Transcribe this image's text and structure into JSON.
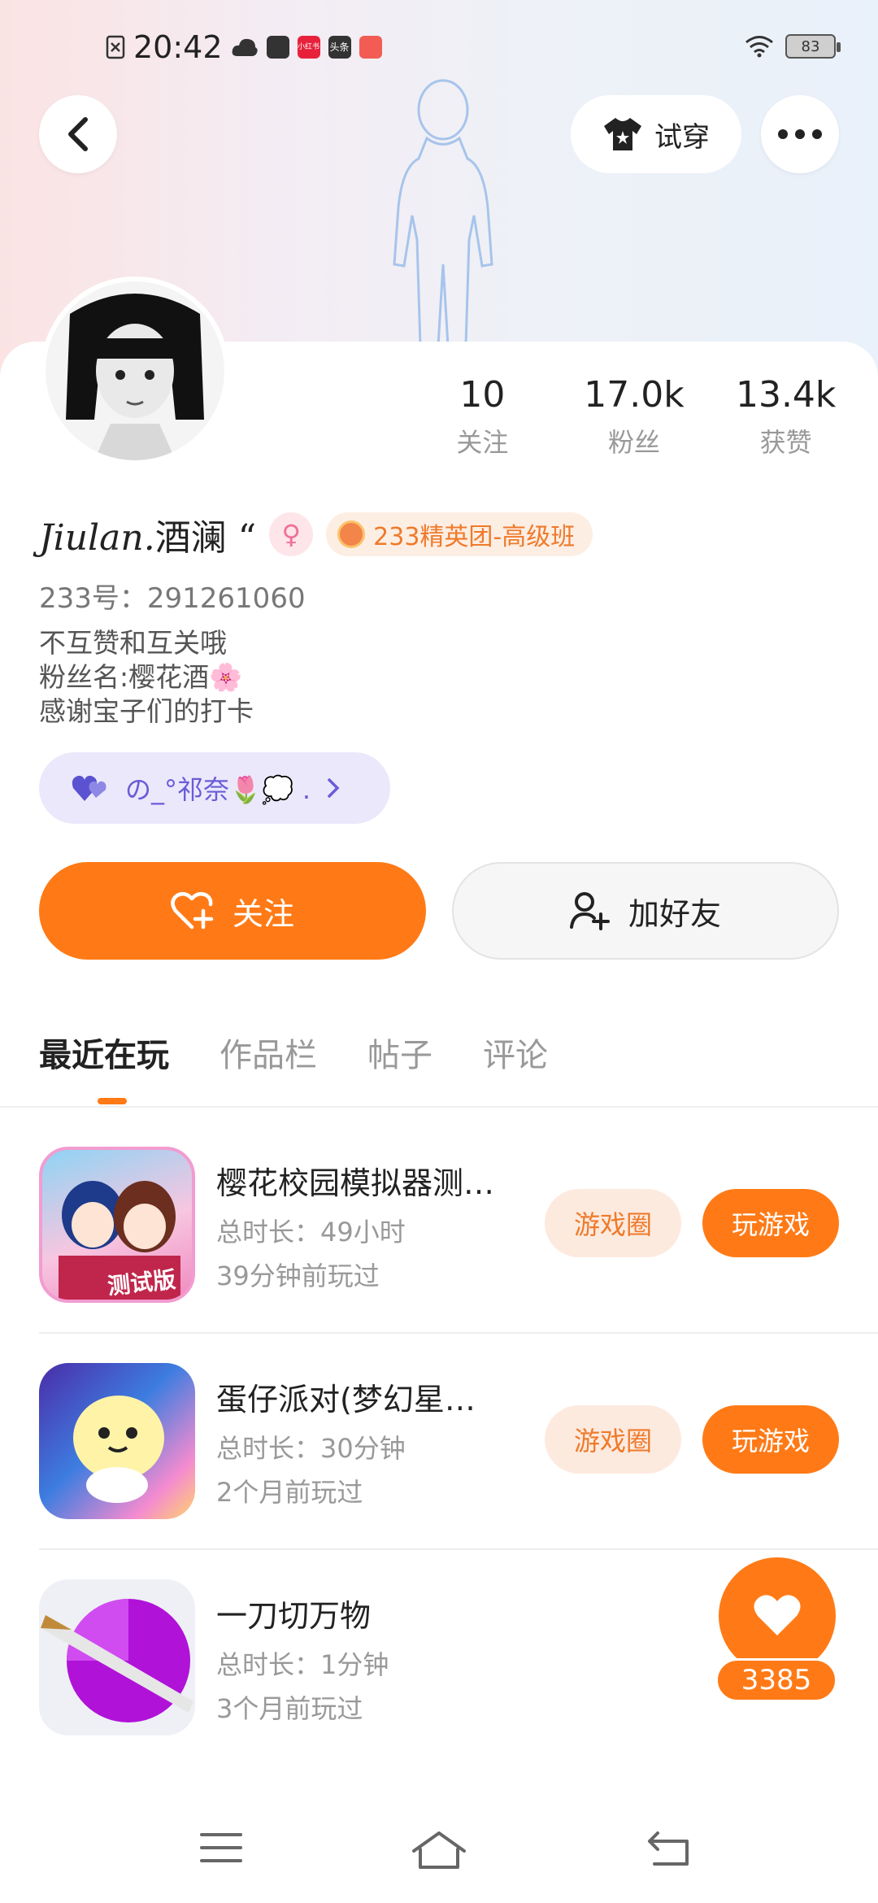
{
  "status_bar": {
    "time": "20:42",
    "battery": "83",
    "icons": [
      "sim-off-icon",
      "cloud-icon",
      "app-icon",
      "xiaohongshu-icon",
      "toutiao-icon",
      "app2-icon",
      "wifi-icon"
    ],
    "app_badges": [
      "小红书",
      "头条"
    ]
  },
  "header": {
    "back_icon": "chevron-left-icon",
    "try_on_label": "试穿",
    "more_icon": "more-dots-icon"
  },
  "profile": {
    "name_latin": "Jiulan.",
    "name_cn": "酒澜 “",
    "gender_icon": "female-icon",
    "badge_label": "233精英团-高级班",
    "uid_text": "233号：291261060",
    "bio_lines": [
      "不互赞和互关哦",
      "粉丝名:樱花酒🌸",
      "感谢宝子们的打卡"
    ],
    "cp_label": "の_°祁奈🌷💭 .",
    "stats": [
      {
        "num": "10",
        "label": "关注"
      },
      {
        "num": "17.0k",
        "label": "粉丝"
      },
      {
        "num": "13.4k",
        "label": "获赞"
      }
    ]
  },
  "actions": {
    "follow_label": "关注",
    "add_friend_label": "加好友"
  },
  "tabs": [
    "最近在玩",
    "作品栏",
    "帖子",
    "评论"
  ],
  "games": [
    {
      "title": "樱花校园模拟器测…",
      "duration": "总时长：49小时",
      "last_played": "39分钟前玩过",
      "icon_text": "测试版",
      "circle_label": "游戏圈",
      "play_label": "玩游戏"
    },
    {
      "title": "蛋仔派对(梦幻星…",
      "duration": "总时长：30分钟",
      "last_played": "2个月前玩过",
      "circle_label": "游戏圈",
      "play_label": "玩游戏"
    },
    {
      "title": "一刀切万物",
      "duration": "总时长：1分钟",
      "last_played": "3个月前玩过"
    }
  ],
  "like_float": {
    "count": "3385"
  },
  "colors": {
    "accent": "#ff7a16",
    "accent_light": "#fdeadf",
    "cp_bg": "#ebe8fb",
    "cp_text": "#6a5cd8"
  }
}
